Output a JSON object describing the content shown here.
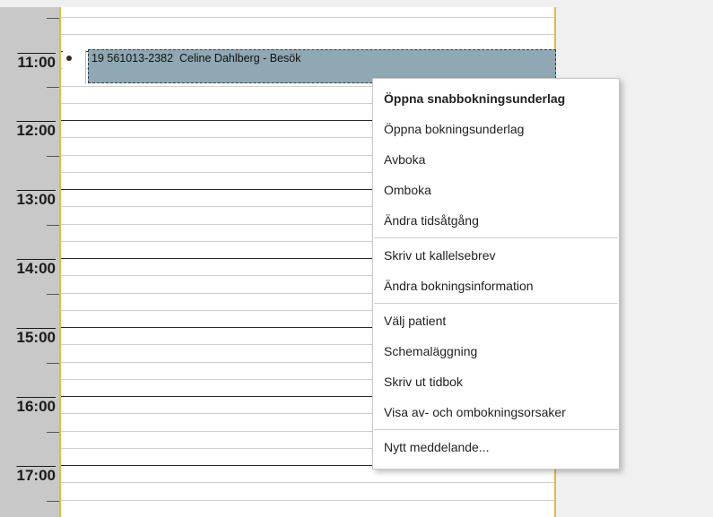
{
  "time_gutter": {
    "hours": [
      "11:00",
      "12:00",
      "13:00",
      "14:00",
      "15:00",
      "16:00",
      "17:00"
    ]
  },
  "booking": {
    "text": "19 561013-2382  Celine Dahlberg - Besök",
    "color": "#8fa8b3"
  },
  "context_menu": {
    "groups": [
      [
        "Öppna snabbokningsunderlag",
        "Öppna bokningsunderlag",
        "Avboka",
        "Omboka",
        "Ändra tidsåtgång"
      ],
      [
        "Skriv ut kallelsebrev",
        "Ändra bokningsinformation"
      ],
      [
        "Välj patient",
        "Schemaläggning",
        "Skriv ut tidbok",
        "Visa av- och ombokningsorsaker"
      ],
      [
        "Nytt meddelande..."
      ]
    ]
  },
  "colors": {
    "column_border": "#e8b83a",
    "gutter": "#c8c8c8"
  }
}
